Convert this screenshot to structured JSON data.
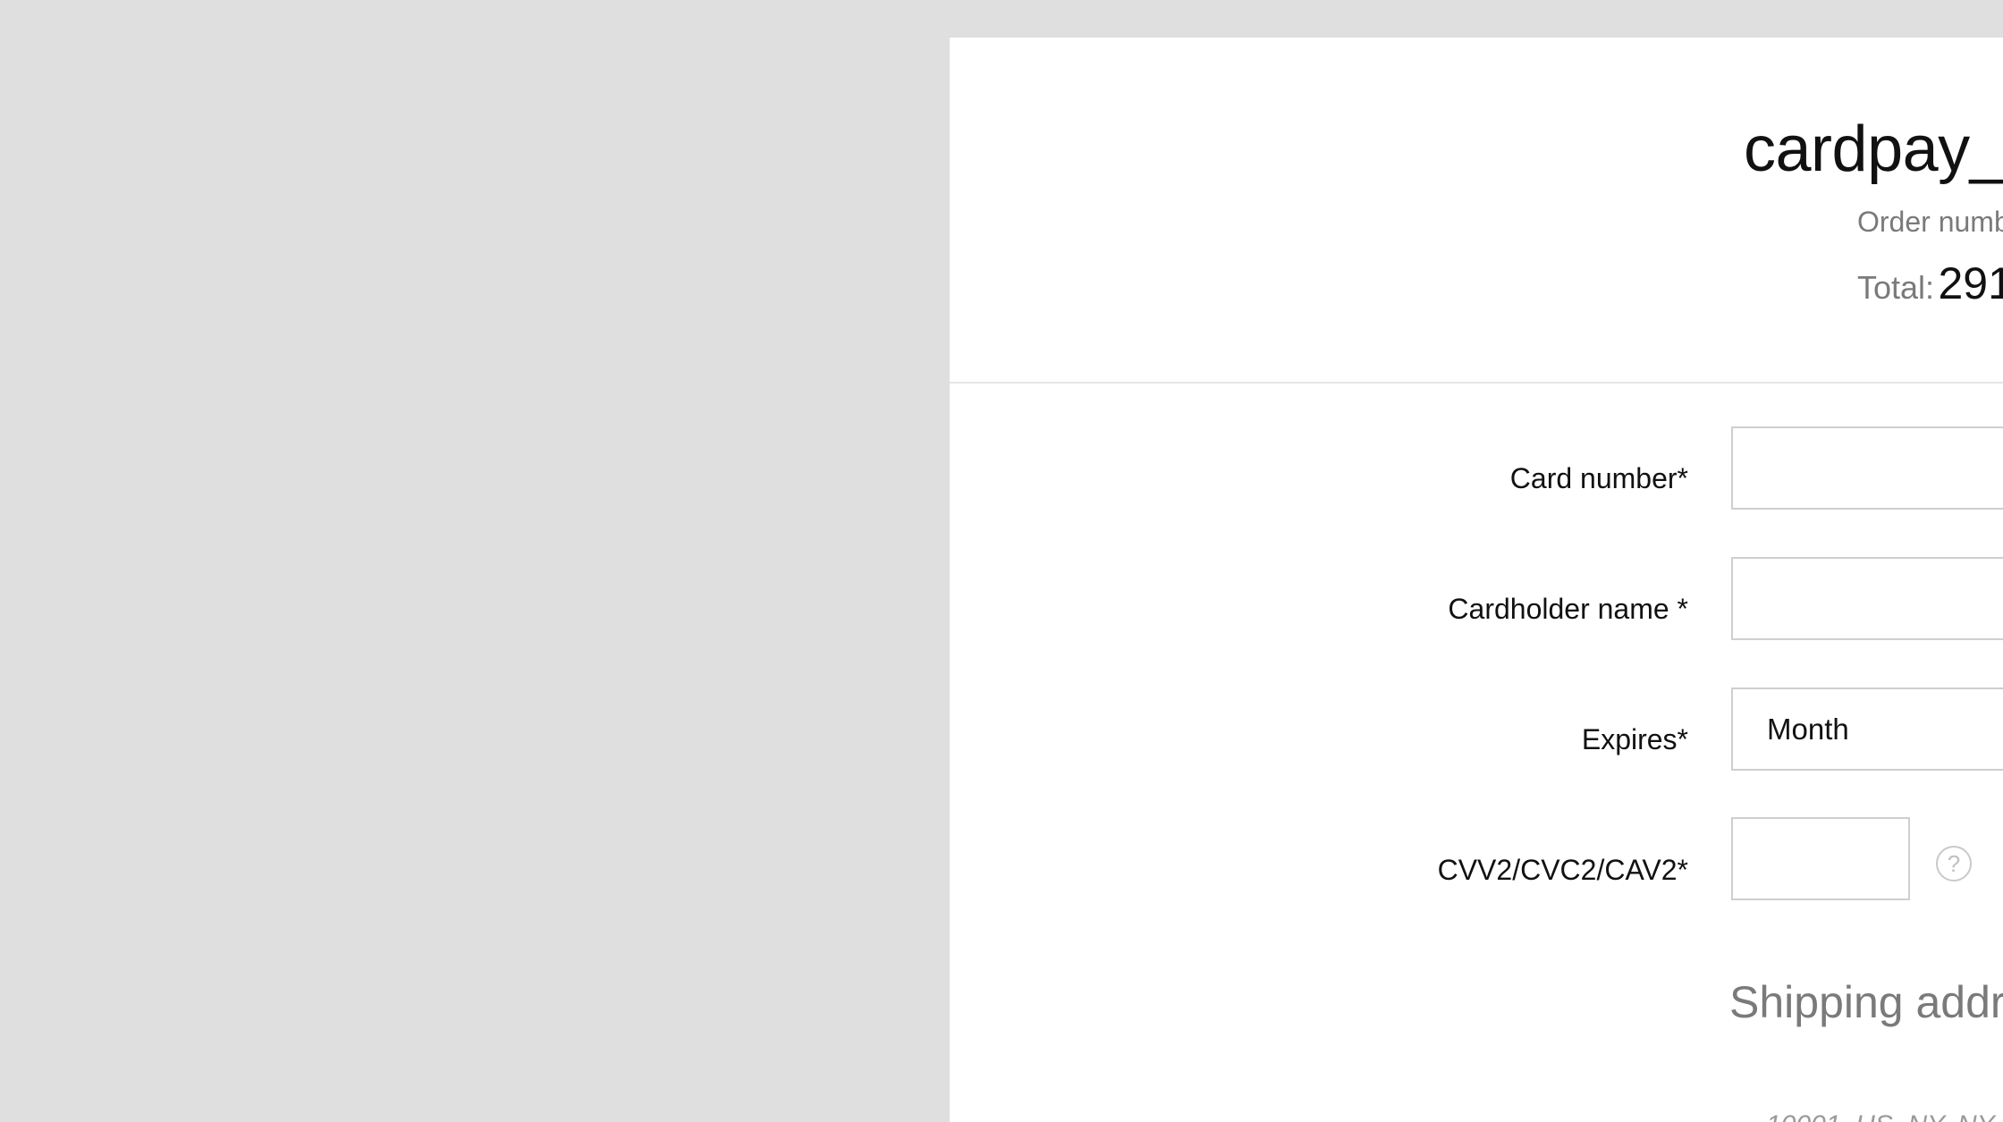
{
  "payment": {
    "merchant_name": "cardpay_",
    "order_label": "Order numb",
    "total_label": "Total:",
    "total_value": "291"
  },
  "form": {
    "card_number_label": "Card number*",
    "cardholder_label": "Cardholder name *",
    "expires_label": "Expires*",
    "expires_month_value": "Month",
    "cvv_label": "CVV2/CVC2/CAV2*",
    "cvv_help_glyph": "?"
  },
  "shipping": {
    "title": "Shipping addr",
    "address_line": "10001, US, NY, NY"
  }
}
